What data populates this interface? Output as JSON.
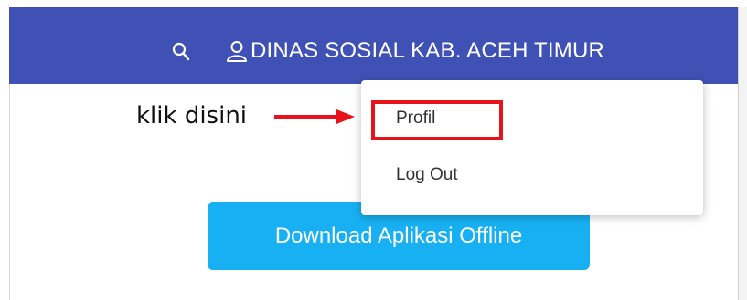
{
  "navbar": {
    "background": "#3f51b5",
    "search_icon": "search-icon",
    "user_icon": "user-icon",
    "user_name": "DINAS SOSIAL KAB. ACEH TIMUR"
  },
  "user_menu": {
    "items": [
      {
        "label": "Profil"
      },
      {
        "label": "Log Out"
      }
    ]
  },
  "main": {
    "download_button_label": "Download Aplikasi Offline",
    "download_button_color": "#17b0f3"
  },
  "annotation": {
    "text": "klik disini",
    "color": "#e8121b",
    "arrow_icon": "arrow-right-icon"
  }
}
